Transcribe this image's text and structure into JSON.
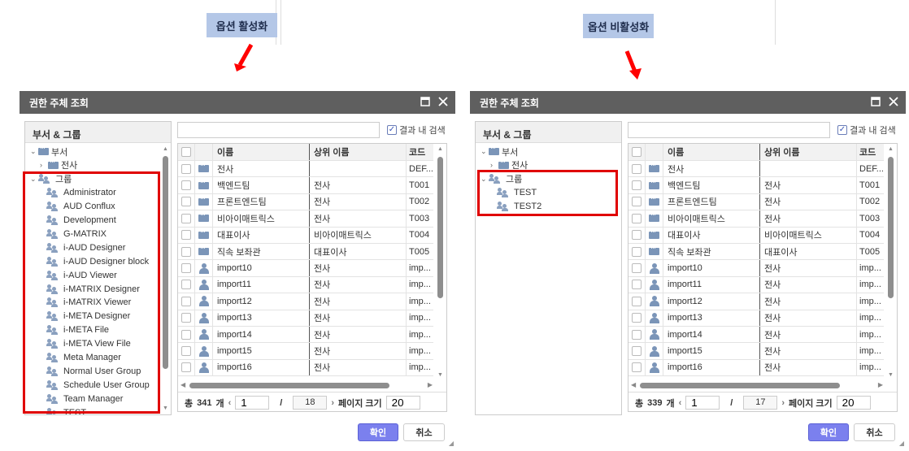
{
  "annotations": {
    "enabled_label": "옵션 활성화",
    "disabled_label": "옵션 비활성화",
    "arrow_color": "#ff0000",
    "highlight_color": "#e00000"
  },
  "dialogs": [
    {
      "title": "권한 주체 조회",
      "tree_header": "부서 & 그룹",
      "tree": [
        {
          "label": "부서",
          "type": "dept",
          "level": 0,
          "caret": "⌄"
        },
        {
          "label": "전사",
          "type": "dept",
          "level": 1,
          "caret": "›"
        },
        {
          "label": "그룹",
          "type": "group",
          "level": 0,
          "caret": "⌄"
        },
        {
          "label": "Administrator",
          "type": "group",
          "level": 2
        },
        {
          "label": "AUD Conflux",
          "type": "group",
          "level": 2
        },
        {
          "label": "Development",
          "type": "group",
          "level": 2
        },
        {
          "label": "G-MATRIX",
          "type": "group",
          "level": 2
        },
        {
          "label": "i-AUD Designer",
          "type": "group",
          "level": 2
        },
        {
          "label": "i-AUD Designer block",
          "type": "group",
          "level": 2
        },
        {
          "label": "i-AUD Viewer",
          "type": "group",
          "level": 2
        },
        {
          "label": "i-MATRIX Designer",
          "type": "group",
          "level": 2
        },
        {
          "label": "i-MATRIX Viewer",
          "type": "group",
          "level": 2
        },
        {
          "label": "i-META Designer",
          "type": "group",
          "level": 2
        },
        {
          "label": "i-META File",
          "type": "group",
          "level": 2
        },
        {
          "label": "i-META View File",
          "type": "group",
          "level": 2
        },
        {
          "label": "Meta Manager",
          "type": "group",
          "level": 2
        },
        {
          "label": "Normal User Group",
          "type": "group",
          "level": 2
        },
        {
          "label": "Schedule User Group",
          "type": "group",
          "level": 2
        },
        {
          "label": "Team Manager",
          "type": "group",
          "level": 2
        },
        {
          "label": "TEST",
          "type": "group",
          "level": 2
        }
      ],
      "search_within_label": "결과 내 검색",
      "search_within_checked": true,
      "search_value": "",
      "columns": [
        "이름",
        "상위 이름",
        "코드"
      ],
      "rows": [
        {
          "type": "dept",
          "name": "전사",
          "parent": "",
          "code": "DEF..."
        },
        {
          "type": "dept",
          "name": "백엔드팀",
          "parent": "전사",
          "code": "T001"
        },
        {
          "type": "dept",
          "name": "프론트엔드팀",
          "parent": "전사",
          "code": "T002"
        },
        {
          "type": "dept",
          "name": "비아이매트릭스",
          "parent": "전사",
          "code": "T003"
        },
        {
          "type": "dept",
          "name": "대표이사",
          "parent": "비아이매트릭스",
          "code": "T004"
        },
        {
          "type": "dept",
          "name": "직속 보좌관",
          "parent": "대표이사",
          "code": "T005"
        },
        {
          "type": "user",
          "name": "import10",
          "parent": "전사",
          "code": "imp..."
        },
        {
          "type": "user",
          "name": "import11",
          "parent": "전사",
          "code": "imp..."
        },
        {
          "type": "user",
          "name": "import12",
          "parent": "전사",
          "code": "imp..."
        },
        {
          "type": "user",
          "name": "import13",
          "parent": "전사",
          "code": "imp..."
        },
        {
          "type": "user",
          "name": "import14",
          "parent": "전사",
          "code": "imp..."
        },
        {
          "type": "user",
          "name": "import15",
          "parent": "전사",
          "code": "imp..."
        },
        {
          "type": "user",
          "name": "import16",
          "parent": "전사",
          "code": "imp..."
        }
      ],
      "pager": {
        "total_prefix": "총",
        "total": "341",
        "total_suffix": "개",
        "page": "1",
        "sep": "/",
        "pages": "18",
        "size_label": "페이지 크기",
        "size": "20"
      },
      "ok_label": "확인",
      "cancel_label": "취소"
    },
    {
      "title": "권한 주체 조회",
      "tree_header": "부서 & 그룹",
      "tree": [
        {
          "label": "부서",
          "type": "dept",
          "level": 0,
          "caret": "⌄"
        },
        {
          "label": "전사",
          "type": "dept",
          "level": 1,
          "caret": "›"
        },
        {
          "label": "그룹",
          "type": "group",
          "level": 0,
          "caret": "⌄"
        },
        {
          "label": "TEST",
          "type": "group",
          "level": 2
        },
        {
          "label": "TEST2",
          "type": "group",
          "level": 2
        }
      ],
      "search_within_label": "결과 내 검색",
      "search_within_checked": true,
      "search_value": "",
      "columns": [
        "이름",
        "상위 이름",
        "코드"
      ],
      "rows": [
        {
          "type": "dept",
          "name": "전사",
          "parent": "",
          "code": "DEF..."
        },
        {
          "type": "dept",
          "name": "백엔드팀",
          "parent": "전사",
          "code": "T001"
        },
        {
          "type": "dept",
          "name": "프론트엔드팀",
          "parent": "전사",
          "code": "T002"
        },
        {
          "type": "dept",
          "name": "비아이매트릭스",
          "parent": "전사",
          "code": "T003"
        },
        {
          "type": "dept",
          "name": "대표이사",
          "parent": "비아이매트릭스",
          "code": "T004"
        },
        {
          "type": "dept",
          "name": "직속 보좌관",
          "parent": "대표이사",
          "code": "T005"
        },
        {
          "type": "user",
          "name": "import10",
          "parent": "전사",
          "code": "imp..."
        },
        {
          "type": "user",
          "name": "import11",
          "parent": "전사",
          "code": "imp..."
        },
        {
          "type": "user",
          "name": "import12",
          "parent": "전사",
          "code": "imp..."
        },
        {
          "type": "user",
          "name": "import13",
          "parent": "전사",
          "code": "imp..."
        },
        {
          "type": "user",
          "name": "import14",
          "parent": "전사",
          "code": "imp..."
        },
        {
          "type": "user",
          "name": "import15",
          "parent": "전사",
          "code": "imp..."
        },
        {
          "type": "user",
          "name": "import16",
          "parent": "전사",
          "code": "imp..."
        }
      ],
      "pager": {
        "total_prefix": "총",
        "total": "339",
        "total_suffix": "개",
        "page": "1",
        "sep": "/",
        "pages": "17",
        "size_label": "페이지 크기",
        "size": "20"
      },
      "ok_label": "확인",
      "cancel_label": "취소"
    }
  ]
}
